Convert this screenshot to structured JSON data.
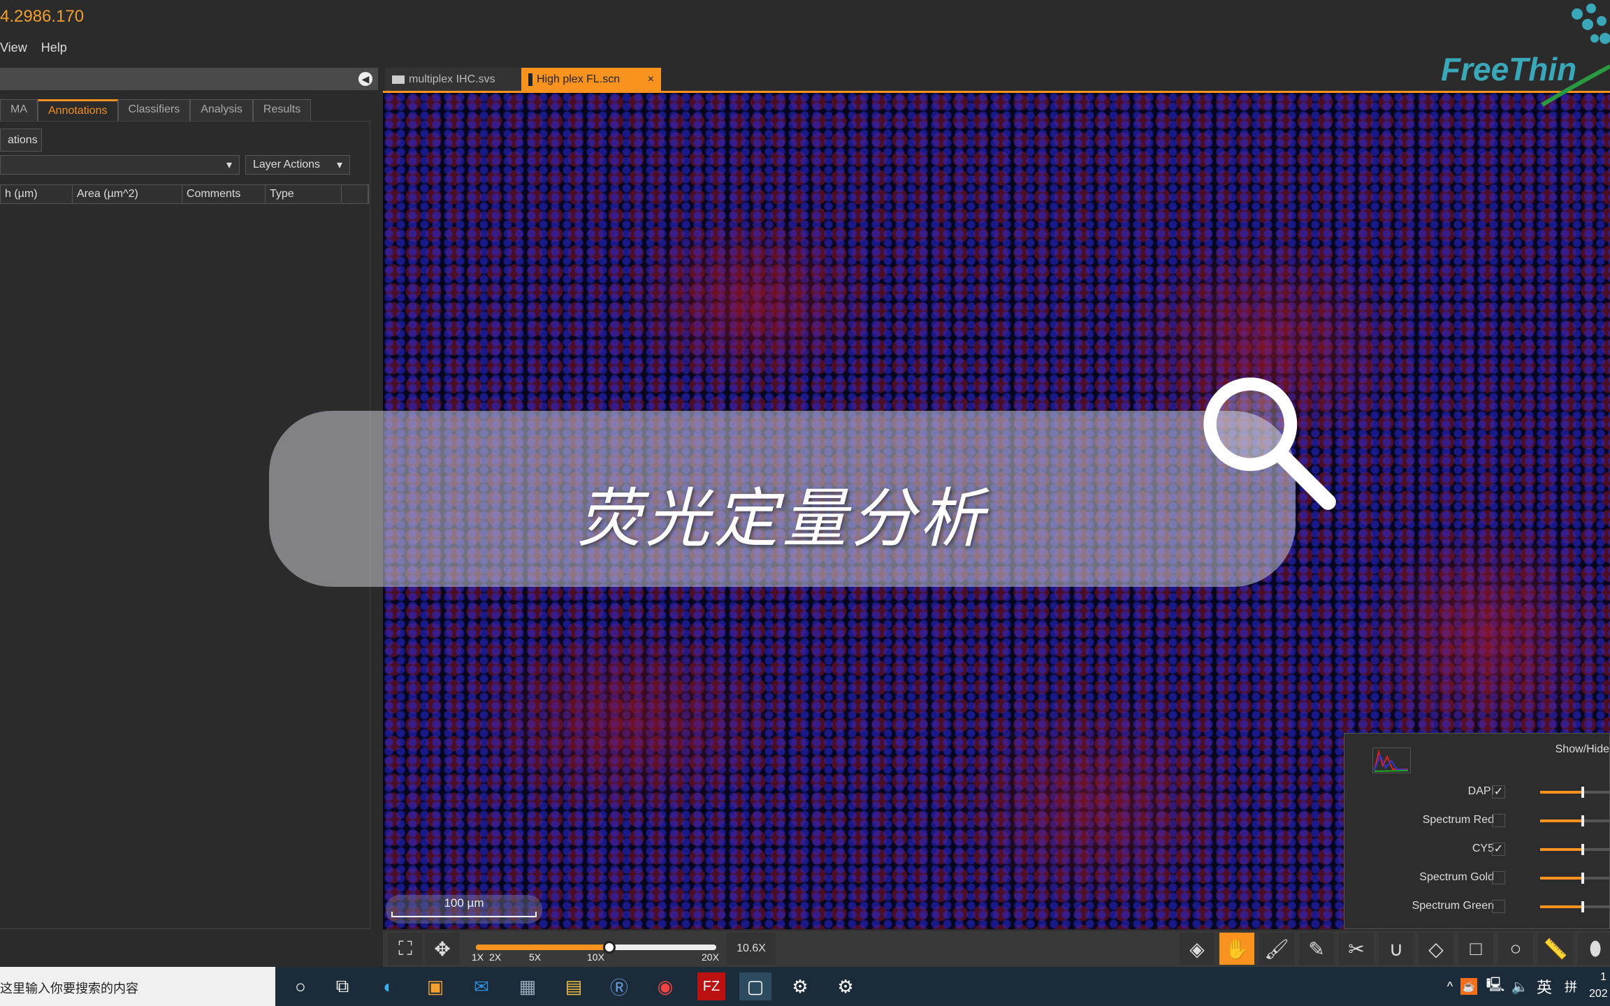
{
  "app": {
    "title": "4.2986.170",
    "menu": [
      "View",
      "Help"
    ]
  },
  "panel": {
    "tabs": [
      "MA",
      "Annotations",
      "Classifiers",
      "Analysis",
      "Results"
    ],
    "active_tab": "Annotations",
    "button": "ations",
    "layer_actions": "Layer Actions",
    "columns": [
      "h (µm)",
      "Area (µm^2)",
      "Comments",
      "Type",
      ""
    ]
  },
  "image_tabs": [
    {
      "label": "multiplex IHC.svs",
      "active": false
    },
    {
      "label": "High plex FL.scn",
      "active": true,
      "close": "×"
    }
  ],
  "overlay": {
    "text": "荧光定量分析"
  },
  "logo": {
    "text": "FreeThink"
  },
  "scale_bar": "100 µm",
  "zoom": {
    "labels": [
      "1X",
      "2X",
      "5X",
      "10X",
      "20X"
    ],
    "value": "10.6X",
    "fraction": 0.56
  },
  "channels": {
    "header": "Show/Hide",
    "items": [
      {
        "name": "DAPI",
        "checked": true,
        "level": 0.6
      },
      {
        "name": "Spectrum Red",
        "checked": false,
        "level": 0.6
      },
      {
        "name": "CY5",
        "checked": true,
        "level": 0.6
      },
      {
        "name": "Spectrum Gold",
        "checked": false,
        "level": 0.6
      },
      {
        "name": "Spectrum Green",
        "checked": false,
        "level": 0.6
      }
    ]
  },
  "tools": [
    "layers-icon",
    "hand-icon",
    "brush-icon",
    "pencil-icon",
    "scissors-icon",
    "magnet-icon",
    "fill-icon",
    "rectangle-icon",
    "circle-icon",
    "ruler-icon",
    "pin-icon"
  ],
  "active_tool": "hand-icon",
  "taskbar": {
    "search_placeholder": "在这里输入你要搜索的内容",
    "ime": "英",
    "ime2": "拼",
    "clock_time": "1",
    "clock_date": "202"
  },
  "colors": {
    "accent": "#f7931e"
  }
}
